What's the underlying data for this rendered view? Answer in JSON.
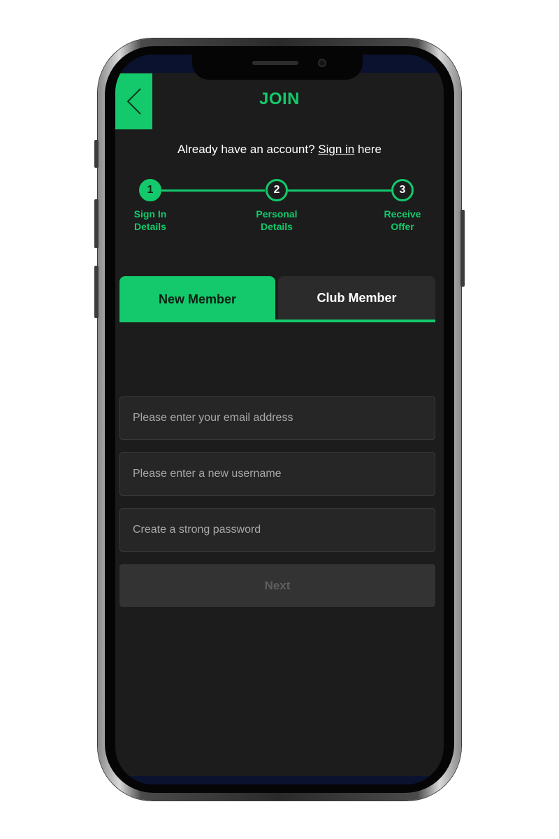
{
  "colors": {
    "accent": "#13c96b",
    "screen_background": "#1c1c1c",
    "field_background": "#262626",
    "tab_inactive": "#2b2b2b",
    "button_disabled": "#333333"
  },
  "header": {
    "back_icon": "chevron-left-icon",
    "title": "JOIN"
  },
  "signin_prompt": {
    "prefix": "Already have an account? ",
    "link_label": "Sign in",
    "suffix": " here"
  },
  "stepper": {
    "current_step": 1,
    "steps": [
      {
        "number": "1",
        "label_line1": "Sign In",
        "label_line2": "Details"
      },
      {
        "number": "2",
        "label_line1": "Personal",
        "label_line2": "Details"
      },
      {
        "number": "3",
        "label_line1": "Receive",
        "label_line2": "Offer"
      }
    ]
  },
  "tabs": {
    "active": "New Member",
    "items": [
      {
        "label": "New Member"
      },
      {
        "label": "Club Member"
      }
    ]
  },
  "form": {
    "email": {
      "placeholder": "Please enter your email address",
      "value": ""
    },
    "username": {
      "placeholder": "Please enter a new username",
      "value": ""
    },
    "password": {
      "placeholder": "Create a strong password",
      "value": ""
    },
    "next_label": "Next"
  }
}
